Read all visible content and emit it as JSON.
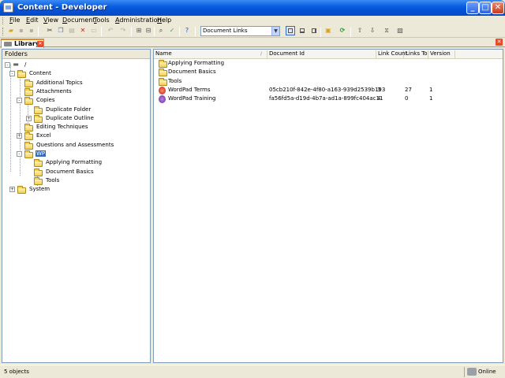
{
  "window": {
    "title": "Content - Developer"
  },
  "menu": [
    "File",
    "Edit",
    "View",
    "Document",
    "Tools",
    "Administration",
    "Help"
  ],
  "toolbar": {
    "view_combo": "Document Links"
  },
  "tab": {
    "label": "Library"
  },
  "folders_panel": {
    "header": "Folders"
  },
  "tree": [
    {
      "label": "/",
      "exp": "-"
    },
    {
      "label": "Content",
      "exp": "-"
    },
    {
      "label": "Additional Topics"
    },
    {
      "label": "Attachments"
    },
    {
      "label": "Copies",
      "exp": "-"
    },
    {
      "label": "Duplicate Folder"
    },
    {
      "label": "Duplicate Outline",
      "exp": "+"
    },
    {
      "label": "Editing Techniques"
    },
    {
      "label": "Excel",
      "exp": "+"
    },
    {
      "label": "Questions and Assessments"
    },
    {
      "label": "WP",
      "exp": "-",
      "selected": true
    },
    {
      "label": "Applying Formatting"
    },
    {
      "label": "Document Basics"
    },
    {
      "label": "Tools"
    },
    {
      "label": "System",
      "exp": "+"
    }
  ],
  "grid": {
    "columns": [
      "Name",
      "Document Id",
      "Link Count",
      "Links To",
      "Version"
    ],
    "rows": [
      {
        "name": "Applying Formatting",
        "type": "folder",
        "doc_id": "",
        "link_count": "",
        "links_to": "",
        "version": ""
      },
      {
        "name": "Document Basics",
        "type": "folder",
        "doc_id": "",
        "link_count": "",
        "links_to": "",
        "version": ""
      },
      {
        "name": "Tools",
        "type": "folder",
        "doc_id": "",
        "link_count": "",
        "links_to": "",
        "version": ""
      },
      {
        "name": "WordPad Terms",
        "type": "glossary",
        "doc_id": "05cb210f-842e-4f80-a163-939d2539b193",
        "link_count": "3",
        "links_to": "27",
        "version": "1"
      },
      {
        "name": "WordPad Training",
        "type": "module",
        "doc_id": "fa56fd5a-d19d-4b7a-ad1a-899fc404ac11",
        "link_count": "4",
        "links_to": "0",
        "version": "1"
      }
    ]
  },
  "status": {
    "objects": "5 objects",
    "connection": "Online"
  },
  "colors": {
    "selection": "#316ac5",
    "title_bar": "#0a5ee0",
    "panel_border": "#7f9db9"
  }
}
